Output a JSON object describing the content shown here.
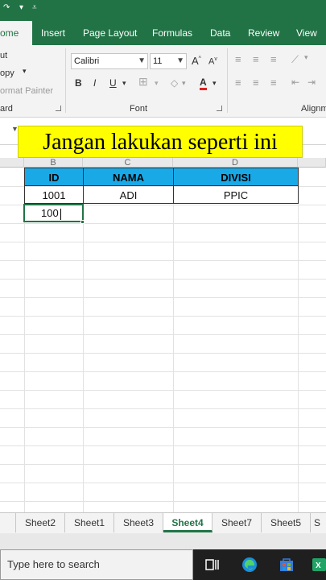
{
  "ribbon_tabs": [
    {
      "label": "Home",
      "visible": "ome",
      "active": true
    },
    {
      "label": "Insert"
    },
    {
      "label": "Page Layout"
    },
    {
      "label": "Formulas"
    },
    {
      "label": "Data"
    },
    {
      "label": "Review"
    },
    {
      "label": "View"
    }
  ],
  "clipboard": {
    "cut": "ut",
    "copy": "opy",
    "format_painter": "ormat Painter",
    "group_label": "ard"
  },
  "font": {
    "name": "Calibri",
    "size": "11",
    "grow": "A",
    "shrink": "A",
    "bold": "B",
    "italic": "I",
    "underline": "U",
    "font_color": "A",
    "group_label": "Font"
  },
  "alignment": {
    "group_label": "Alignm"
  },
  "banner": {
    "text": "Jangan lakukan seperti ini"
  },
  "grid": {
    "columns": [
      "B",
      "C",
      "D"
    ],
    "table": {
      "headers": [
        "ID",
        "NAMA",
        "DIVISI"
      ],
      "row": [
        "1001",
        "ADI",
        "PPIC"
      ]
    },
    "active_cell_value": "100"
  },
  "sheet_tabs": [
    {
      "label": "Sheet2"
    },
    {
      "label": "Sheet1"
    },
    {
      "label": "Sheet3"
    },
    {
      "label": "Sheet4",
      "active": true
    },
    {
      "label": "Sheet7"
    },
    {
      "label": "Sheet5"
    },
    {
      "label": "S"
    }
  ],
  "taskbar": {
    "search_placeholder": "Type here to search"
  },
  "colors": {
    "excel_green": "#217346",
    "header_fill": "#19a9e6",
    "banner_fill": "#ffff00"
  }
}
